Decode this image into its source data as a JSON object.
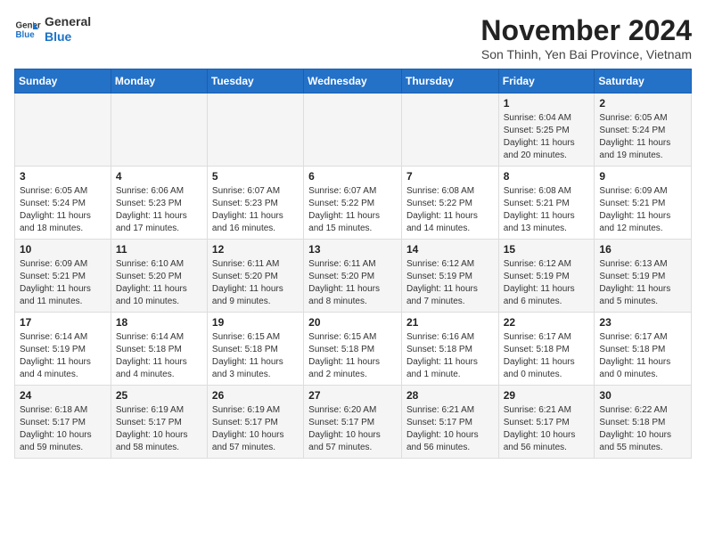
{
  "header": {
    "logo_line1": "General",
    "logo_line2": "Blue",
    "month_title": "November 2024",
    "subtitle": "Son Thinh, Yen Bai Province, Vietnam"
  },
  "weekdays": [
    "Sunday",
    "Monday",
    "Tuesday",
    "Wednesday",
    "Thursday",
    "Friday",
    "Saturday"
  ],
  "weeks": [
    [
      {
        "day": "",
        "info": ""
      },
      {
        "day": "",
        "info": ""
      },
      {
        "day": "",
        "info": ""
      },
      {
        "day": "",
        "info": ""
      },
      {
        "day": "",
        "info": ""
      },
      {
        "day": "1",
        "info": "Sunrise: 6:04 AM\nSunset: 5:25 PM\nDaylight: 11 hours and 20 minutes."
      },
      {
        "day": "2",
        "info": "Sunrise: 6:05 AM\nSunset: 5:24 PM\nDaylight: 11 hours and 19 minutes."
      }
    ],
    [
      {
        "day": "3",
        "info": "Sunrise: 6:05 AM\nSunset: 5:24 PM\nDaylight: 11 hours and 18 minutes."
      },
      {
        "day": "4",
        "info": "Sunrise: 6:06 AM\nSunset: 5:23 PM\nDaylight: 11 hours and 17 minutes."
      },
      {
        "day": "5",
        "info": "Sunrise: 6:07 AM\nSunset: 5:23 PM\nDaylight: 11 hours and 16 minutes."
      },
      {
        "day": "6",
        "info": "Sunrise: 6:07 AM\nSunset: 5:22 PM\nDaylight: 11 hours and 15 minutes."
      },
      {
        "day": "7",
        "info": "Sunrise: 6:08 AM\nSunset: 5:22 PM\nDaylight: 11 hours and 14 minutes."
      },
      {
        "day": "8",
        "info": "Sunrise: 6:08 AM\nSunset: 5:21 PM\nDaylight: 11 hours and 13 minutes."
      },
      {
        "day": "9",
        "info": "Sunrise: 6:09 AM\nSunset: 5:21 PM\nDaylight: 11 hours and 12 minutes."
      }
    ],
    [
      {
        "day": "10",
        "info": "Sunrise: 6:09 AM\nSunset: 5:21 PM\nDaylight: 11 hours and 11 minutes."
      },
      {
        "day": "11",
        "info": "Sunrise: 6:10 AM\nSunset: 5:20 PM\nDaylight: 11 hours and 10 minutes."
      },
      {
        "day": "12",
        "info": "Sunrise: 6:11 AM\nSunset: 5:20 PM\nDaylight: 11 hours and 9 minutes."
      },
      {
        "day": "13",
        "info": "Sunrise: 6:11 AM\nSunset: 5:20 PM\nDaylight: 11 hours and 8 minutes."
      },
      {
        "day": "14",
        "info": "Sunrise: 6:12 AM\nSunset: 5:19 PM\nDaylight: 11 hours and 7 minutes."
      },
      {
        "day": "15",
        "info": "Sunrise: 6:12 AM\nSunset: 5:19 PM\nDaylight: 11 hours and 6 minutes."
      },
      {
        "day": "16",
        "info": "Sunrise: 6:13 AM\nSunset: 5:19 PM\nDaylight: 11 hours and 5 minutes."
      }
    ],
    [
      {
        "day": "17",
        "info": "Sunrise: 6:14 AM\nSunset: 5:19 PM\nDaylight: 11 hours and 4 minutes."
      },
      {
        "day": "18",
        "info": "Sunrise: 6:14 AM\nSunset: 5:18 PM\nDaylight: 11 hours and 4 minutes."
      },
      {
        "day": "19",
        "info": "Sunrise: 6:15 AM\nSunset: 5:18 PM\nDaylight: 11 hours and 3 minutes."
      },
      {
        "day": "20",
        "info": "Sunrise: 6:15 AM\nSunset: 5:18 PM\nDaylight: 11 hours and 2 minutes."
      },
      {
        "day": "21",
        "info": "Sunrise: 6:16 AM\nSunset: 5:18 PM\nDaylight: 11 hours and 1 minute."
      },
      {
        "day": "22",
        "info": "Sunrise: 6:17 AM\nSunset: 5:18 PM\nDaylight: 11 hours and 0 minutes."
      },
      {
        "day": "23",
        "info": "Sunrise: 6:17 AM\nSunset: 5:18 PM\nDaylight: 11 hours and 0 minutes."
      }
    ],
    [
      {
        "day": "24",
        "info": "Sunrise: 6:18 AM\nSunset: 5:17 PM\nDaylight: 10 hours and 59 minutes."
      },
      {
        "day": "25",
        "info": "Sunrise: 6:19 AM\nSunset: 5:17 PM\nDaylight: 10 hours and 58 minutes."
      },
      {
        "day": "26",
        "info": "Sunrise: 6:19 AM\nSunset: 5:17 PM\nDaylight: 10 hours and 57 minutes."
      },
      {
        "day": "27",
        "info": "Sunrise: 6:20 AM\nSunset: 5:17 PM\nDaylight: 10 hours and 57 minutes."
      },
      {
        "day": "28",
        "info": "Sunrise: 6:21 AM\nSunset: 5:17 PM\nDaylight: 10 hours and 56 minutes."
      },
      {
        "day": "29",
        "info": "Sunrise: 6:21 AM\nSunset: 5:17 PM\nDaylight: 10 hours and 56 minutes."
      },
      {
        "day": "30",
        "info": "Sunrise: 6:22 AM\nSunset: 5:18 PM\nDaylight: 10 hours and 55 minutes."
      }
    ]
  ]
}
